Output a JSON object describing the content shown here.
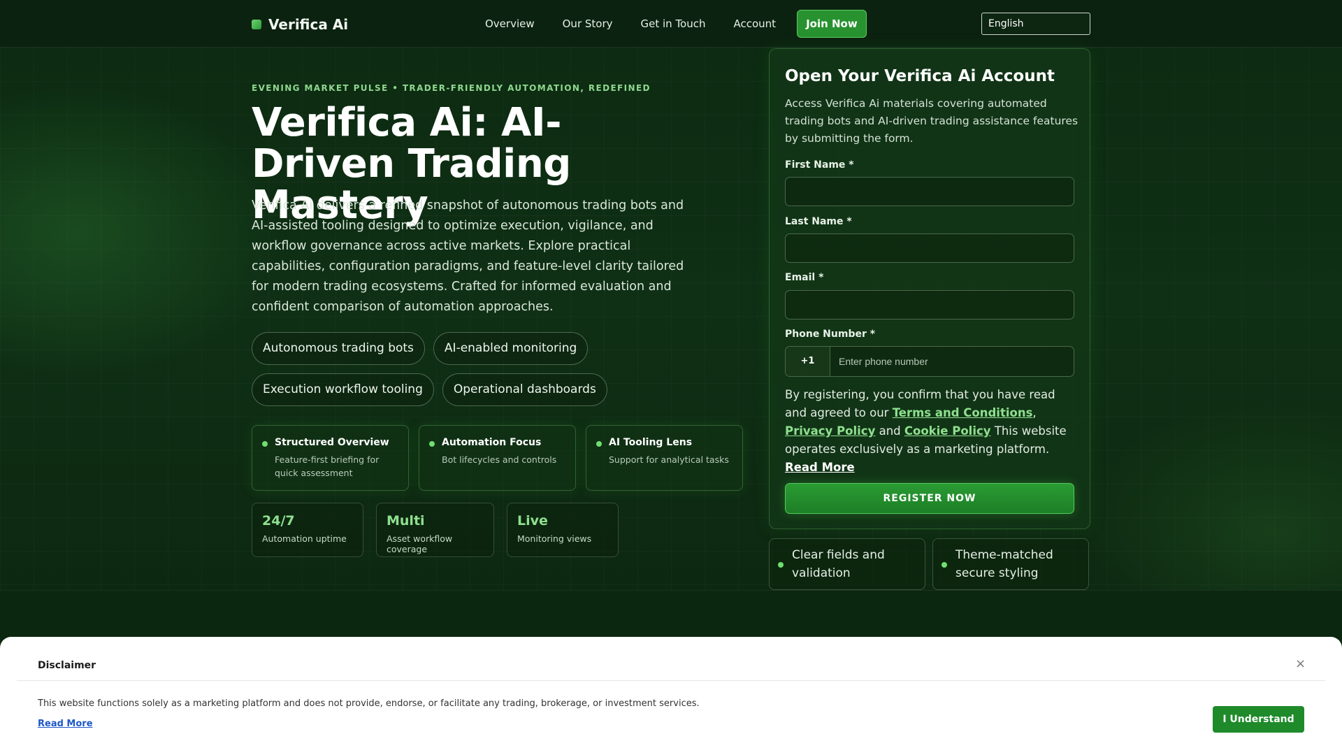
{
  "colors": {
    "accent": "#27922f",
    "accent_light": "#8fe08f",
    "background": "#0c2a11",
    "link": "#1e57c9"
  },
  "header": {
    "brand": "Verifica Ai",
    "nav": [
      "Overview",
      "Our Story",
      "Get in Touch",
      "Account"
    ],
    "join_label": "Join Now",
    "language": "English"
  },
  "hero": {
    "kicker": "EVENING MARKET PULSE • TRADER-FRIENDLY AUTOMATION, REDEFINED",
    "title": "Verifica Ai: AI-Driven Trading Mastery",
    "description": "Verifica Ai delivers a refined snapshot of autonomous trading bots and AI-assisted tooling designed to optimize execution, vigilance, and workflow governance across active markets. Explore practical capabilities, configuration paradigms, and feature-level clarity tailored for modern trading ecosystems. Crafted for informed evaluation and confident comparison of automation approaches.",
    "pills": [
      "Autonomous trading bots",
      "AI-enabled monitoring",
      "Execution workflow tooling",
      "Operational dashboards"
    ],
    "features": [
      {
        "title": "Structured Overview",
        "sub": "Feature-first briefing for quick assessment"
      },
      {
        "title": "Automation Focus",
        "sub": "Bot lifecycles and controls"
      },
      {
        "title": "AI Tooling Lens",
        "sub": "Support for analytical tasks"
      }
    ],
    "stats": [
      {
        "value": "24/7",
        "label": "Automation uptime"
      },
      {
        "value": "Multi",
        "label": "Asset workflow coverage"
      },
      {
        "value": "Live",
        "label": "Monitoring views"
      }
    ]
  },
  "form": {
    "title": "Open Your Verifica Ai Account",
    "description": "Access Verifica Ai materials covering automated trading bots and AI-driven trading assistance features by submitting the form.",
    "first_name_label": "First Name *",
    "last_name_label": "Last Name *",
    "email_label": "Email *",
    "phone_label": "Phone Number *",
    "phone_code": "+1",
    "phone_placeholder": "Enter phone number",
    "consent_prefix": "By registering, you confirm that you have read and agreed to our",
    "terms": "Terms and Conditions",
    "privacy": "Privacy Policy",
    "cookie": "Cookie Policy",
    "consent_suffix": "This website operates exclusively as a marketing platform.",
    "read_more": "Read More",
    "submit_label": "REGISTER NOW"
  },
  "mini_features": [
    "Clear fields and validation",
    "Theme-matched secure styling"
  ],
  "disclaimer": {
    "title": "Disclaimer",
    "close": "×",
    "text": "This website functions solely as a marketing platform and does not provide, endorse, or facilitate any trading, brokerage, or investment services.",
    "read_more": "Read More",
    "button": "I Understand"
  }
}
